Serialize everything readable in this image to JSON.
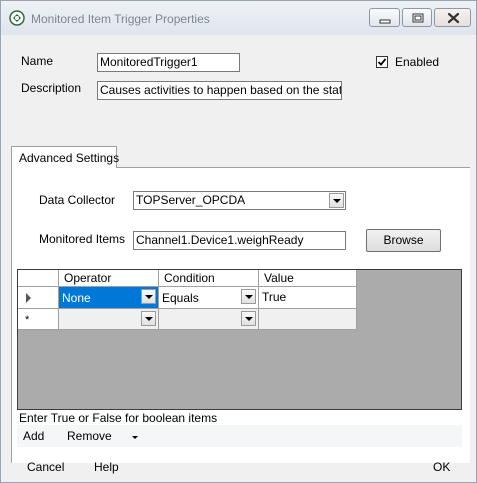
{
  "window": {
    "title": "Monitored Item Trigger Properties"
  },
  "form": {
    "name_label": "Name",
    "name_value": "MonitoredTrigger1",
    "description_label": "Description",
    "description_value": "Causes activities to happen based on the state of a",
    "enabled_label": "Enabled",
    "enabled_checked": true
  },
  "tabs": [
    {
      "label": "Advanced Settings",
      "selected": true
    }
  ],
  "advanced": {
    "data_collector_label": "Data Collector",
    "data_collector_value": "TOPServer_OPCDA",
    "monitored_items_label": "Monitored Items",
    "monitored_items_value": "Channel1.Device1.weighReady",
    "browse_label": "Browse"
  },
  "grid": {
    "columns": [
      "Operator",
      "Condition",
      "Value"
    ],
    "rows": [
      {
        "marker": "current",
        "operator": "None",
        "condition": "Equals",
        "value": "True"
      },
      {
        "marker": "new",
        "operator": "",
        "condition": "",
        "value": ""
      }
    ],
    "new_row_glyph": "*"
  },
  "hint": "Enter True or False for boolean items",
  "toolbar": {
    "add_label": "Add",
    "remove_label": "Remove"
  },
  "footer": {
    "cancel_label": "Cancel",
    "help_label": "Help",
    "ok_label": "OK"
  },
  "colors": {
    "selection": "#0078d7",
    "grid_background": "#ababab"
  }
}
